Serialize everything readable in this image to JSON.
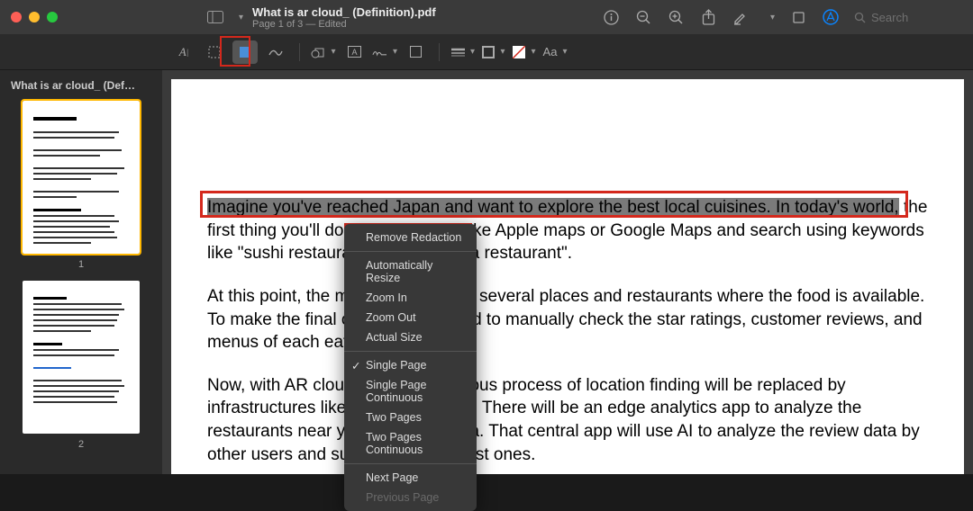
{
  "window": {
    "title": "What is ar cloud_ (Definition).pdf",
    "subtitle": "Page 1 of 3 — Edited"
  },
  "sidebar": {
    "title": "What is ar cloud_ (Def…",
    "thumbs": [
      {
        "num": "1"
      },
      {
        "num": "2"
      }
    ]
  },
  "toolbar": {
    "search_placeholder": "Search",
    "aa_label": "Aa"
  },
  "document": {
    "redacted_line": "Imagine you've reached Japan and want to explore the best local cuisines. In today's world,",
    "p1_rest": " the first thing you'll do is open an app like Apple maps or Google Maps and search using keywords like \"sushi restaurant near me\" or \"a restaurant\".",
    "p2": "At this point, the map app will show several places and restaurants where the food is available. To make the final choice, you'll need to manually check the star ratings, customer reviews, and menus of each eatery.",
    "p3": "Now, with AR cloud, this super tedious process of location finding will be replaced by infrastructures like edge computing. There will be an edge analytics app to analyze the restaurants near you from your data. That central app will use AI to analyze the review data by other users and suggest you the best ones."
  },
  "context_menu": {
    "items": [
      {
        "label": "Remove Redaction",
        "sep_after": true
      },
      {
        "label": "Automatically Resize"
      },
      {
        "label": "Zoom In"
      },
      {
        "label": "Zoom Out"
      },
      {
        "label": "Actual Size",
        "sep_after": true
      },
      {
        "label": "Single Page",
        "checked": true
      },
      {
        "label": "Single Page Continuous"
      },
      {
        "label": "Two Pages"
      },
      {
        "label": "Two Pages Continuous",
        "sep_after": true
      },
      {
        "label": "Next Page"
      },
      {
        "label": "Previous Page",
        "disabled": true
      }
    ]
  },
  "annotation_boxes": {
    "toolbar_redact": true,
    "redacted_text": true,
    "remove_redaction_item": true
  }
}
